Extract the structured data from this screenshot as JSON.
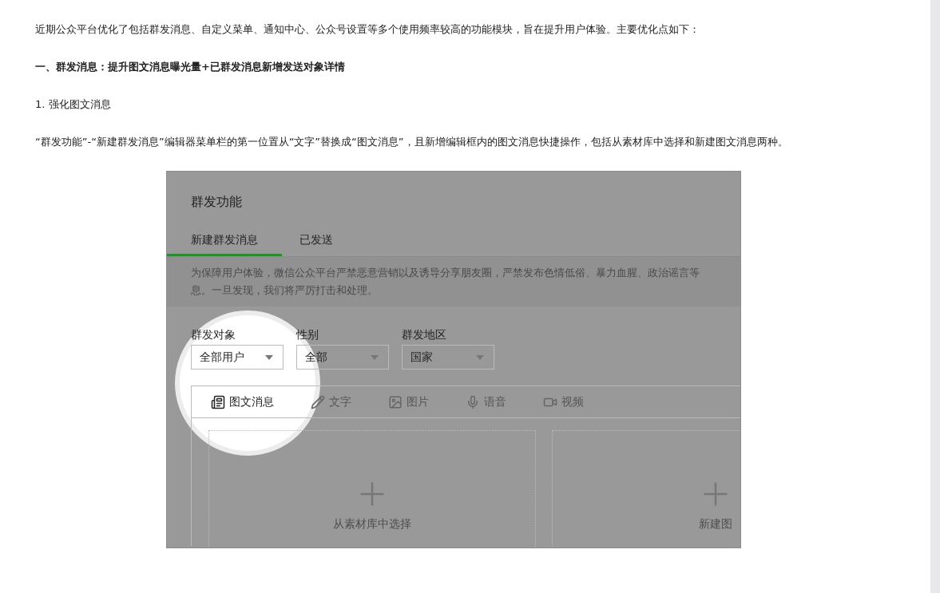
{
  "article": {
    "intro": "近期公众平台优化了包括群发消息、自定义菜单、通知中心、公众号设置等多个使用频率较高的功能模块，旨在提升用户体验。主要优化点如下：",
    "heading": "一、群发消息：提升图文消息曝光量+已群发消息新增发送对象详情",
    "subheading": "1. 强化图文消息",
    "paragraph": "“群发功能”-“新建群发消息”编辑器菜单栏的第一位置从“文字”替换成“图文消息”，且新增编辑框内的图文消息快捷操作，包括从素材库中选择和新建图文消息两种。"
  },
  "figure": {
    "title": "群发功能",
    "tabs": [
      {
        "label": "新建群发消息",
        "selected": true
      },
      {
        "label": "已发送",
        "selected": false
      }
    ],
    "notice": [
      "为保障用户体验，微信公众平台严禁恶意营销以及诱导分享朋友圈，严禁发布色情低俗、暴力血腥、政治谣言等",
      "息。一旦发现，我们将严厉打击和处理。"
    ],
    "filters": [
      {
        "label": "群发对象",
        "value": "全部用户"
      },
      {
        "label": "性别",
        "value": "全部"
      },
      {
        "label": "群发地区",
        "value": "国家"
      }
    ],
    "toolbar": [
      {
        "kind": "news",
        "label": "图文消息"
      },
      {
        "kind": "text",
        "label": "文字"
      },
      {
        "kind": "image",
        "label": "图片"
      },
      {
        "kind": "voice",
        "label": "语音"
      },
      {
        "kind": "video",
        "label": "视频"
      }
    ],
    "cards": [
      {
        "label": "从素材库中选择"
      },
      {
        "label": "新建图"
      }
    ]
  }
}
